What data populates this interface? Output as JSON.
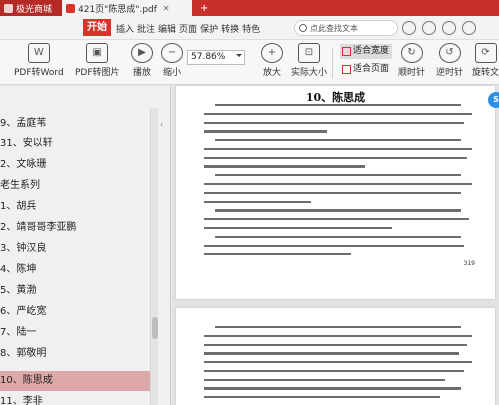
{
  "tabs": [
    {
      "label": "极光商城"
    },
    {
      "label": "421页\"陈思成\".pdf",
      "close": "✕"
    }
  ],
  "menu": {
    "brand": "开始",
    "items": [
      "插入",
      "批注",
      "编辑",
      "页面",
      "保护",
      "转换",
      "特色"
    ],
    "search_placeholder": "点此查找文本"
  },
  "toolbar": {
    "pdf_to_word": "PDF转Word",
    "pdf_to_image": "PDF转图片",
    "play": "播放",
    "zoom_out": "缩小",
    "zoom_value": "57.86%",
    "zoom_in": "放大",
    "actual_size": "实际大小",
    "fit_width": "适合宽度",
    "fit_page": "适合页面",
    "rotate_cw": "顺时针",
    "rotate_ccw": "逆时针",
    "rotate_doc": "旋转文"
  },
  "sidebar": {
    "items": [
      {
        "label": "9、孟庭苇",
        "active": false
      },
      {
        "label": "31、安以轩",
        "active": false
      },
      {
        "label": "2、文咏珊",
        "active": false
      },
      {
        "label": "老生系列",
        "active": false
      },
      {
        "label": "1、胡兵",
        "active": false
      },
      {
        "label": "2、靖哥哥李亚鹏",
        "active": false
      },
      {
        "label": "3、钟汉良",
        "active": false
      },
      {
        "label": "4、陈坤",
        "active": false
      },
      {
        "label": "5、黄渤",
        "active": false
      },
      {
        "label": "6、严屹宽",
        "active": false
      },
      {
        "label": "7、陆一",
        "active": false
      },
      {
        "label": "8、郭敬明",
        "active": false
      },
      {
        "label": "10、陈思成",
        "active": true
      },
      {
        "label": "11、李非",
        "active": false
      }
    ]
  },
  "document": {
    "page_title": "10、陈思成",
    "page_number": "319",
    "badge": "S"
  }
}
